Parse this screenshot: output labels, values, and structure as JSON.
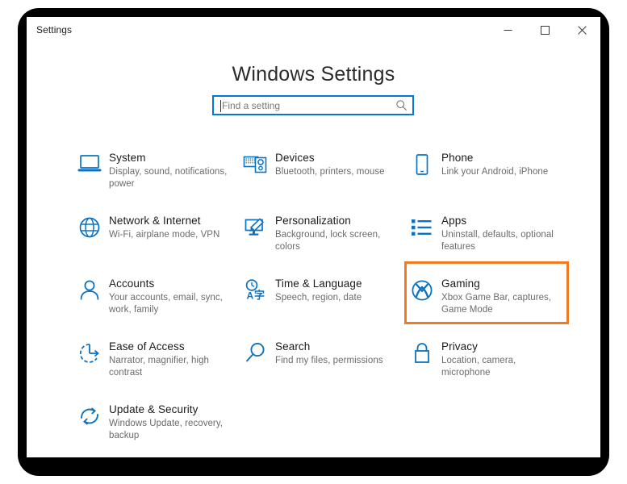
{
  "window": {
    "title": "Settings",
    "caption_buttons": [
      {
        "name": "minimize",
        "label": "Minimize"
      },
      {
        "name": "maximize",
        "label": "Maximize"
      },
      {
        "name": "close",
        "label": "Close"
      }
    ]
  },
  "header": {
    "heading": "Windows Settings"
  },
  "search": {
    "value": "",
    "placeholder": "Find a setting",
    "icon": "search-icon",
    "focused": true,
    "border_color": "#0078d4"
  },
  "highlight": {
    "target": "Gaming",
    "color": "#f47a20"
  },
  "accent_color": "#0078d4",
  "tiles": [
    {
      "id": "system",
      "icon": "laptop-icon",
      "title": "System",
      "desc": "Display, sound, notifications, power"
    },
    {
      "id": "devices",
      "icon": "devices-icon",
      "title": "Devices",
      "desc": "Bluetooth, printers, mouse"
    },
    {
      "id": "phone",
      "icon": "phone-icon",
      "title": "Phone",
      "desc": "Link your Android, iPhone"
    },
    {
      "id": "network",
      "icon": "globe-icon",
      "title": "Network & Internet",
      "desc": "Wi-Fi, airplane mode, VPN"
    },
    {
      "id": "personalization",
      "icon": "paintbrush-monitor-icon",
      "title": "Personalization",
      "desc": "Background, lock screen, colors"
    },
    {
      "id": "apps",
      "icon": "list-icon",
      "title": "Apps",
      "desc": "Uninstall, defaults, optional features"
    },
    {
      "id": "accounts",
      "icon": "person-icon",
      "title": "Accounts",
      "desc": "Your accounts, email, sync, work, family"
    },
    {
      "id": "time-language",
      "icon": "clock-language-icon",
      "title": "Time & Language",
      "desc": "Speech, region, date"
    },
    {
      "id": "gaming",
      "icon": "xbox-icon",
      "title": "Gaming",
      "desc": "Xbox Game Bar, captures, Game Mode"
    },
    {
      "id": "ease-of-access",
      "icon": "ease-of-access-icon",
      "title": "Ease of Access",
      "desc": "Narrator, magnifier, high contrast"
    },
    {
      "id": "search",
      "icon": "magnifier-icon",
      "title": "Search",
      "desc": "Find my files, permissions"
    },
    {
      "id": "privacy",
      "icon": "lock-icon",
      "title": "Privacy",
      "desc": "Location, camera, microphone"
    },
    {
      "id": "update-security",
      "icon": "refresh-icon",
      "title": "Update & Security",
      "desc": "Windows Update, recovery, backup"
    }
  ]
}
